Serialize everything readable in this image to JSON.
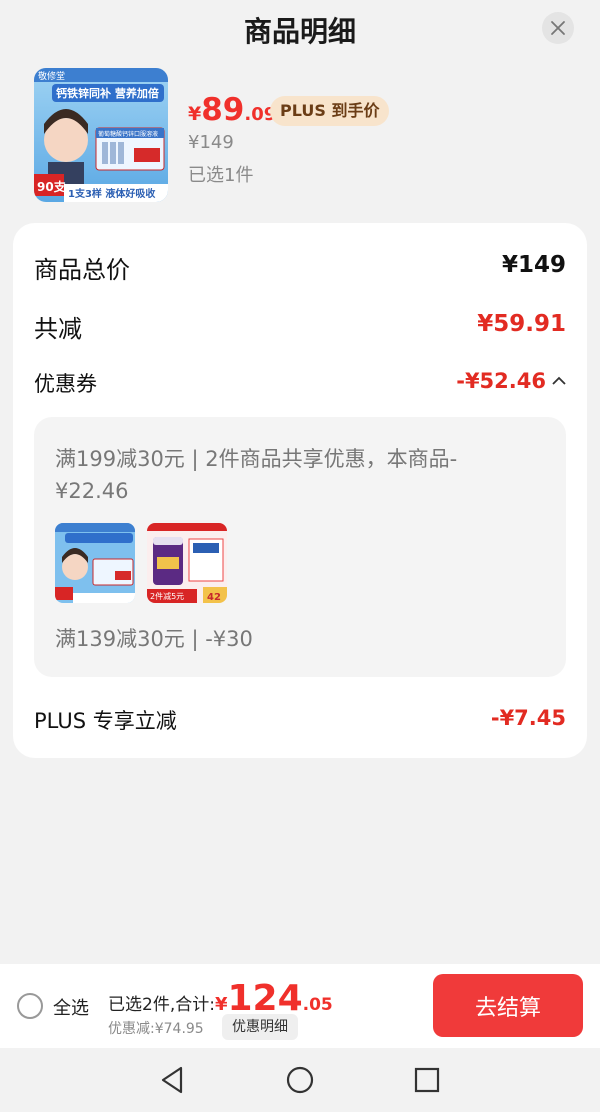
{
  "header": {
    "title": "商品明细",
    "close_icon": "close-icon"
  },
  "product": {
    "price_symbol": "¥",
    "price_integer": "89",
    "price_decimal": ".09",
    "plus_badge": "PLUS 到手价",
    "original_price": "¥149",
    "selected": "已选1件",
    "thumb_texts": {
      "brand": "敬修堂",
      "banner": "钙铁锌同补 营养加倍",
      "product_name": "葡萄糖酸钙锌口服溶液",
      "count": "90支",
      "slogan": "1支3样 液体好吸收"
    }
  },
  "summary": {
    "total_label": "商品总价",
    "total_value": "¥149",
    "reduce_label": "共减",
    "reduce_value": "¥59.91",
    "coupon_label": "优惠券",
    "coupon_value": "-¥52.46",
    "coupon_chevron": "chevron-up-icon",
    "coupon_detail_1": "满199减30元 | 2件商品共享优惠，本商品-¥22.46",
    "coupon_detail_2": "满139减30元 | -¥30",
    "coupon_thumb_2_texts": {
      "badge": "2件减5元",
      "price": "42"
    },
    "plus_label": "PLUS 专享立减",
    "plus_value": "-¥7.45"
  },
  "bottom": {
    "select_all": "全选",
    "total_prefix": "已选2件,合计:",
    "total_symbol": "¥",
    "total_integer": "124",
    "total_decimal": ".05",
    "discount": "优惠减:¥74.95",
    "detail_button": "优惠明细",
    "checkout_button": "去结算"
  },
  "colors": {
    "accent_red": "#f0302b",
    "checkout_red": "#f03a3a",
    "plus_gold": "#f8e4cc"
  },
  "nav": {
    "back_icon": "back-icon",
    "home_icon": "home-icon",
    "recents_icon": "recents-icon"
  }
}
